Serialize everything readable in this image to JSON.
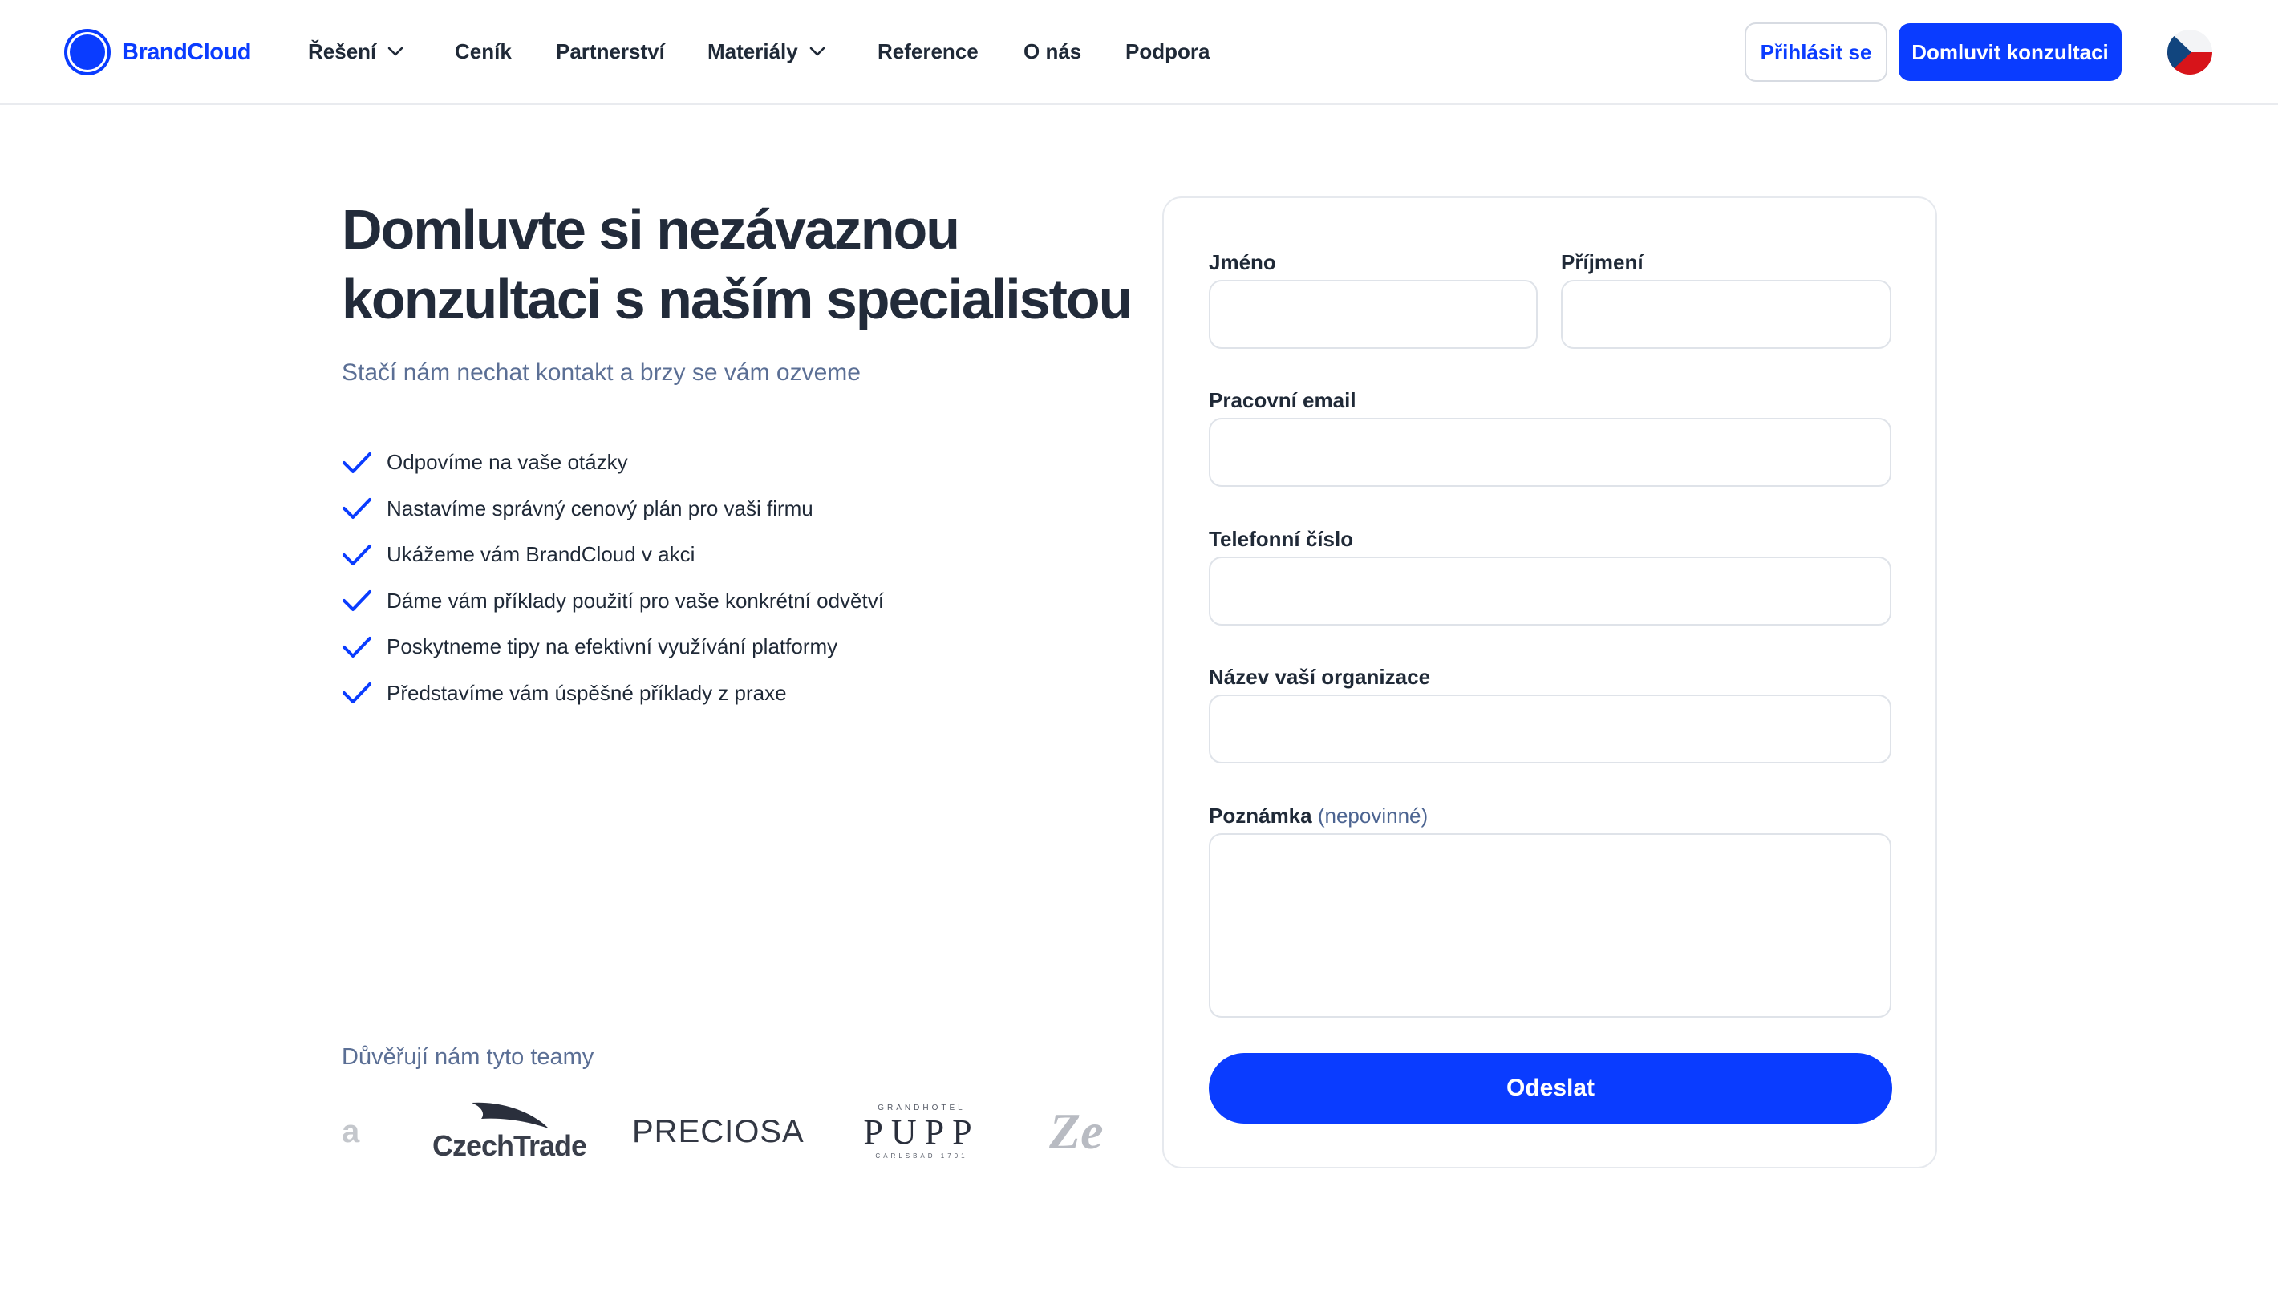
{
  "brand": {
    "name": "BrandCloud",
    "accent": "#0a3cff"
  },
  "nav": {
    "items": [
      {
        "label": "Řešení",
        "has_dropdown": true
      },
      {
        "label": "Ceník",
        "has_dropdown": false
      },
      {
        "label": "Partnerství",
        "has_dropdown": false
      },
      {
        "label": "Materiály",
        "has_dropdown": true
      },
      {
        "label": "Reference",
        "has_dropdown": false
      },
      {
        "label": "O nás",
        "has_dropdown": false
      },
      {
        "label": "Podpora",
        "has_dropdown": false
      }
    ],
    "login_label": "Přihlásit se",
    "consult_label": "Domluvit konzultaci",
    "language_icon": "czech-flag-icon"
  },
  "hero": {
    "title": "Domluvte si nezávaznou konzultaci s naším specialistou",
    "subtitle": "Stačí nám nechat kontakt a brzy se vám ozveme",
    "benefits": [
      "Odpovíme na vaše otázky",
      "Nastavíme správný cenový plán pro vaši firmu",
      "Ukážeme vám BrandCloud v akci",
      "Dáme vám příklady použití pro vaše konkrétní odvětví",
      "Poskytneme tipy na efektivní využívání platformy",
      "Představíme vám úspěšné příklady z praxe"
    ]
  },
  "trust": {
    "label": "Důvěřují nám tyto teamy",
    "logos": [
      {
        "name": "partial-logo-left",
        "text": "a"
      },
      {
        "name": "czechtrade-logo",
        "text": "CzechTrade"
      },
      {
        "name": "preciosa-logo",
        "text": "PRECIOSA"
      },
      {
        "name": "grandhotel-pupp-logo",
        "text": "PUPP",
        "top_text": "GRANDHOTEL",
        "bottom_text": "CARLSBAD 1701"
      },
      {
        "name": "partial-logo-right",
        "text": "Ze"
      }
    ]
  },
  "form": {
    "first_name": {
      "label": "Jméno",
      "value": ""
    },
    "last_name": {
      "label": "Příjmení",
      "value": ""
    },
    "email": {
      "label": "Pracovní email",
      "value": ""
    },
    "phone": {
      "label": "Telefonní číslo",
      "value": ""
    },
    "organization": {
      "label": "Název vaší organizace",
      "value": ""
    },
    "note": {
      "label": "Poznámka",
      "optional": "(nepovinné)",
      "value": ""
    },
    "submit_label": "Odeslat"
  }
}
